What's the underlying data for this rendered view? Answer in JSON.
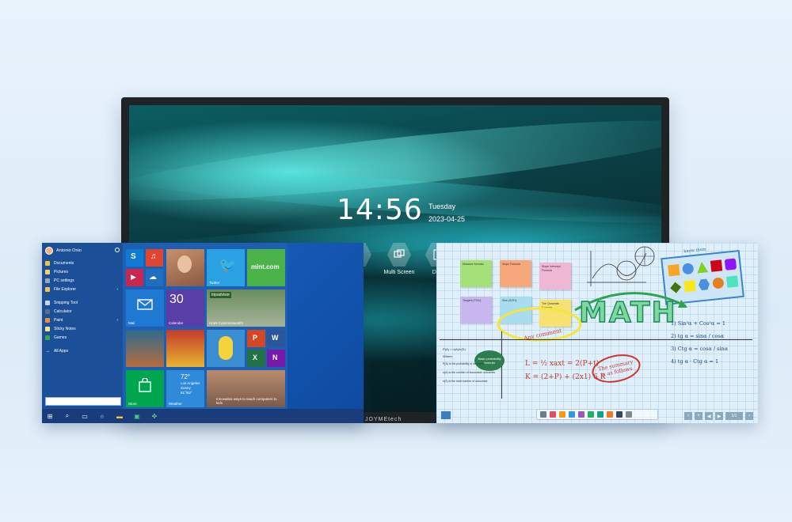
{
  "panel": {
    "time": "14:56",
    "weekday": "Tuesday",
    "date": "2023-04-25",
    "dock": [
      {
        "label": "",
        "icon": "app-icon"
      },
      {
        "label": "",
        "icon": "app-icon"
      },
      {
        "label": "Multi Screen",
        "icon": "multi-screen-icon"
      },
      {
        "label": "Doc",
        "icon": "document-icon"
      }
    ],
    "brand": "JOYMEtech"
  },
  "windows": {
    "user_name": "Antonio Onio",
    "menu_items": [
      {
        "label": "Documents",
        "color": "#f3c33b"
      },
      {
        "label": "Pictures",
        "color": "#ffd35a"
      },
      {
        "label": "PC settings",
        "color": "#9aa7b8"
      },
      {
        "label": "File Explorer",
        "color": "#f4c542",
        "has_arrow": true
      },
      {
        "label": "Snipping Tool",
        "color": "#c9d6e6"
      },
      {
        "label": "Calculator",
        "color": "#5a6f88"
      },
      {
        "label": "Paint",
        "color": "#f28a3b",
        "has_arrow": true
      },
      {
        "label": "Sticky Notes",
        "color": "#f7e37a"
      },
      {
        "label": "Games",
        "color": "#3aa84e"
      }
    ],
    "all_apps": "All Apps",
    "tiles": {
      "twitter": "Twitter",
      "mint": "mint.com",
      "mail": "Mail",
      "calendar_day": "30",
      "calendar": "Calendar",
      "tripadvisor": "tripadvisor",
      "hotel": "Hotel Commonwealth",
      "store": "Store",
      "weather_temp": "72°",
      "weather_city": "Los Angeles",
      "weather_cond": "Sunny",
      "weather_range": "81°/62°",
      "weather": "Weather",
      "news": "Innovative ways to teach computers to kids"
    }
  },
  "whiteboard": {
    "stickies": [
      {
        "text": "Distance formula:",
        "color": "#a5e079"
      },
      {
        "text": "Slope Formula",
        "color": "#f6a77b"
      },
      {
        "text": "Slope Intercept Formula",
        "color": "#f0b7d4"
      },
      {
        "text": "Tangent (TOA):",
        "color": "#c8b7ee"
      },
      {
        "text": "Sine (SOH):",
        "color": "#a8ddf0"
      },
      {
        "text": "The Quadratic Formula",
        "color": "#f7e26f"
      }
    ],
    "math_word": "MATH",
    "bubble": "Basic probability formula",
    "annotation": "Any comment",
    "formula1": "L = ½ xaxt = 2(P+t)",
    "formula2": "K = (2+P) + (2x1) 6 R",
    "summary": "The summary is as follows",
    "trig1": "1) Sin²α + Cos²α = 1",
    "trig2": "2) tg α = sinα / cosα",
    "trig3": "3) Ctg α = cosα / sinα",
    "trig4": "4) tg α · Ctg α = 1",
    "prob_heading": "P(A) = n(A)/n(S)",
    "prob_where": "Where:",
    "prob_lines": [
      "P(A) is the probability of an event",
      "n(A) is the number of favourable outcomes",
      "n(S) is the total number of outcomes"
    ],
    "shapes_label": "know them",
    "page": "1/1"
  }
}
